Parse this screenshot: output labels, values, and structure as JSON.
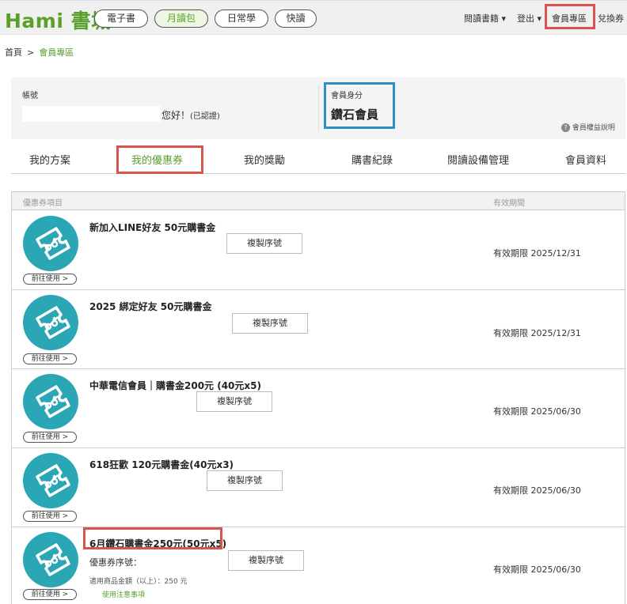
{
  "header": {
    "logo": "Hami 書城",
    "nav": [
      "電子書",
      "月讀包",
      "日常學",
      "快讀"
    ],
    "right": {
      "reading_list": "閱讀書籍",
      "logout": "登出",
      "member_zone": "會員專區",
      "redeem": "兌換券"
    }
  },
  "breadcrumb": {
    "home": "首頁",
    "sep": ">",
    "current": "會員專區"
  },
  "member": {
    "account_label": "帳號",
    "greeting": "您好！",
    "verified": "(已認證)",
    "status_label": "會員身分",
    "status_value": "鑽石會員",
    "rights_link": "會員權益說明"
  },
  "tabs": [
    "我的方案",
    "我的優惠券",
    "我的獎勵",
    "購書紀錄",
    "閱讀設備管理",
    "會員資料"
  ],
  "table": {
    "col_item": "優惠券項目",
    "col_expiry": "有效期間",
    "copy_label": "複製序號",
    "use_label": "前往使用 >",
    "rows": [
      {
        "title": "新加入LINE好友 50元購書金",
        "expiry": "有效期限 2025/12/31"
      },
      {
        "title": "2025 綁定好友 50元購書金",
        "expiry": "有效期限 2025/12/31"
      },
      {
        "title": "中華電信會員｜購書金200元 (40元x5)",
        "expiry": "有效期限 2025/06/30"
      },
      {
        "title": "618狂歡 120元購書金(40元x3)",
        "expiry": "有效期限 2025/06/30"
      },
      {
        "title": "6月鑽石購書金250元(50元x5)",
        "expiry": "有效期限 2025/06/30",
        "serial_label": "優惠券序號：",
        "min_amount": "適用商品金額（以上）：250 元",
        "notes_link": "使用注意事項"
      }
    ]
  },
  "colors": {
    "brand_green": "#5aa02c",
    "highlight_red": "#d9534f",
    "highlight_blue": "#2b8fc8",
    "icon_teal": "#2aa6b5"
  }
}
